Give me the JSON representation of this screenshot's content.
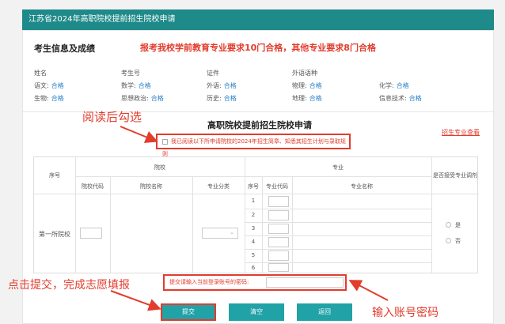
{
  "header": {
    "title": "江苏省2024年高职院校提前招生院校申请"
  },
  "info": {
    "section_title": "考生信息及成绩",
    "notice": "报考我校学前教育专业要求10门合格，其他专业要求8门合格",
    "row1": [
      {
        "label": "姓名",
        "value": ""
      },
      {
        "label": "考生号",
        "value": ""
      },
      {
        "label": "证件",
        "value": ""
      },
      {
        "label": "外语语种",
        "value": ""
      }
    ],
    "row2": [
      {
        "label": "语文:",
        "value": "合格"
      },
      {
        "label": "数学:",
        "value": "合格"
      },
      {
        "label": "外语:",
        "value": "合格"
      },
      {
        "label": "物理:",
        "value": "合格"
      },
      {
        "label": "化学:",
        "value": "合格"
      }
    ],
    "row3": [
      {
        "label": "生物:",
        "value": "合格"
      },
      {
        "label": "思想政治:",
        "value": "合格"
      },
      {
        "label": "历史:",
        "value": "合格"
      },
      {
        "label": "地理:",
        "value": "合格"
      },
      {
        "label": "信息技术:",
        "value": "合格"
      }
    ]
  },
  "annotations": {
    "read": "阅读后勾选",
    "submit": "点击提交，完成志愿填报",
    "pwd": "输入账号密码"
  },
  "form": {
    "title": "高职院校提前招生院校申请",
    "major_link": "招生专业查看",
    "agree_text": "我已阅读以下所申请院校的2024年招生简章、知悉其招生计划与录取规则",
    "table": {
      "col_seq": "序号",
      "col_school": "院校",
      "col_major": "专业",
      "col_accept": "是否接受专业调剂",
      "col_school_code": "院校代码",
      "col_school_name": "院校名称",
      "col_major_cat": "专业分类",
      "col_major_seq": "序号",
      "col_major_code": "专业代码",
      "col_major_name": "专业名称",
      "row_label": "第一所院校",
      "major_rows": [
        "1",
        "2",
        "3",
        "4",
        "5",
        "6"
      ],
      "radio_yes": "是",
      "radio_no": "否"
    },
    "pwd_label": "提交请输入当前登录账号的密码:",
    "buttons": {
      "submit": "提交",
      "clear": "清空",
      "back": "返回"
    }
  }
}
